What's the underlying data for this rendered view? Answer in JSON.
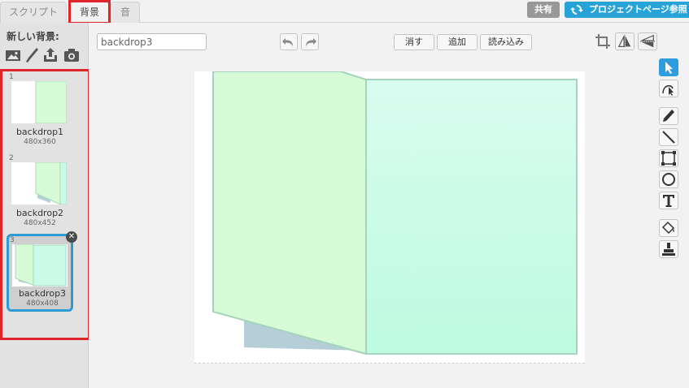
{
  "tabs": [
    {
      "label": "スクリプト",
      "active": false
    },
    {
      "label": "背景",
      "active": true
    },
    {
      "label": "音",
      "active": false
    }
  ],
  "header": {
    "share_label": "共有",
    "project_page_label": "プロジェクトページ参照"
  },
  "sidebar": {
    "new_backdrop_label": "新しい背景:",
    "new_icons": [
      "image-library-icon",
      "paint-brush-icon",
      "upload-icon",
      "camera-icon"
    ],
    "backdrops": [
      {
        "number": "1",
        "name": "backdrop1",
        "size": "480x360",
        "selected": false
      },
      {
        "number": "2",
        "name": "backdrop2",
        "size": "480x452",
        "selected": false
      },
      {
        "number": "3",
        "name": "backdrop3",
        "size": "480x408",
        "selected": true
      }
    ]
  },
  "editor": {
    "name_value": "backdrop3",
    "clear_label": "消す",
    "add_label": "追加",
    "import_label": "読み込み"
  },
  "tools": [
    "select-icon",
    "reshape-icon",
    "pencil-icon",
    "line-icon",
    "rectangle-icon",
    "ellipse-icon",
    "text-icon",
    "fill-icon",
    "stamp-icon"
  ],
  "colors": {
    "highlight": "#e0252a",
    "accent": "#2b9bd1",
    "panel_light_green": "#d6fbd6",
    "panel_mint": "#c2fbe4",
    "shadow": "#b5cfd8"
  }
}
